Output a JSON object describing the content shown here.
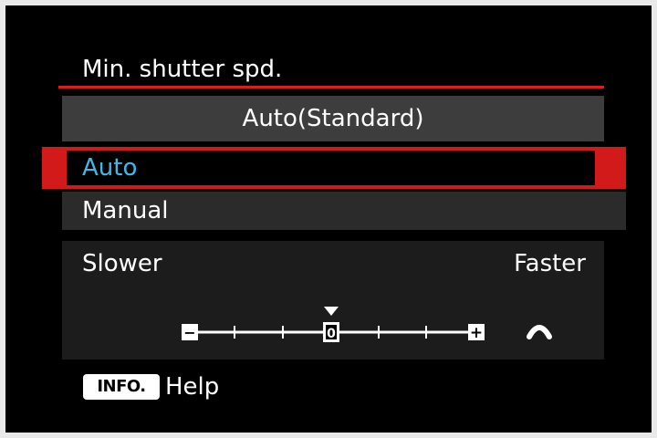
{
  "menu": {
    "title": "Min. shutter spd.",
    "current_setting": "Auto(Standard)",
    "options": [
      {
        "label": "Auto",
        "selected": true
      },
      {
        "label": "Manual",
        "selected": false
      }
    ]
  },
  "scale": {
    "left_label": "Slower",
    "right_label": "Faster",
    "center_value": "0",
    "min_symbol": "−",
    "max_symbol": "+",
    "value": 0,
    "range": [
      -4,
      4
    ]
  },
  "footer": {
    "button_label": "INFO.",
    "help_text": "Help"
  },
  "colors": {
    "background": "#000000",
    "accent_red": "#d21a1a",
    "selected_text": "#44b6e8",
    "panel_gray": "#3d3d3d",
    "text": "#ffffff"
  },
  "icons": {
    "pointer": "triangle-down-icon",
    "dial": "main-dial-icon"
  }
}
